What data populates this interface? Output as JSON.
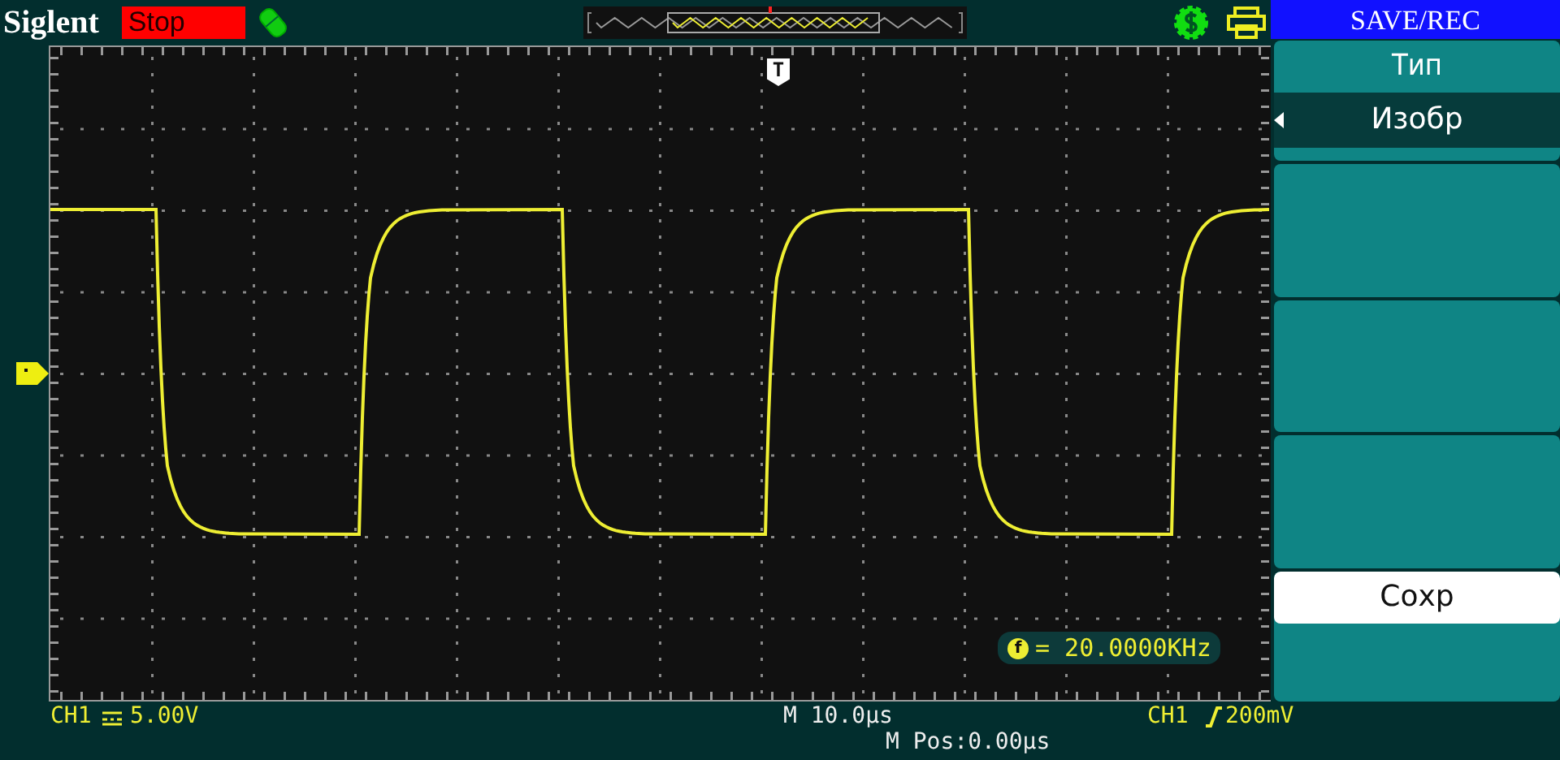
{
  "header": {
    "brand": "Siglent",
    "run_state": "Stop"
  },
  "screen": {
    "trigger_marker": "T",
    "frequency": "= 20.0000KHz",
    "frequency_icon": "f"
  },
  "menu": {
    "title": "SAVE/REC",
    "items": [
      {
        "kind": "option",
        "label": "Тип",
        "value": "Изобр"
      },
      {
        "kind": "blank"
      },
      {
        "kind": "blank"
      },
      {
        "kind": "blank"
      },
      {
        "kind": "action",
        "label": "Сохр"
      }
    ]
  },
  "status": {
    "channel": "CH1",
    "channel_scale": "5.00V",
    "timebase": "M 10.0μs",
    "position": "M Pos:0.00μs",
    "trigger_source": "CH1",
    "trigger_level": "200mV"
  }
}
